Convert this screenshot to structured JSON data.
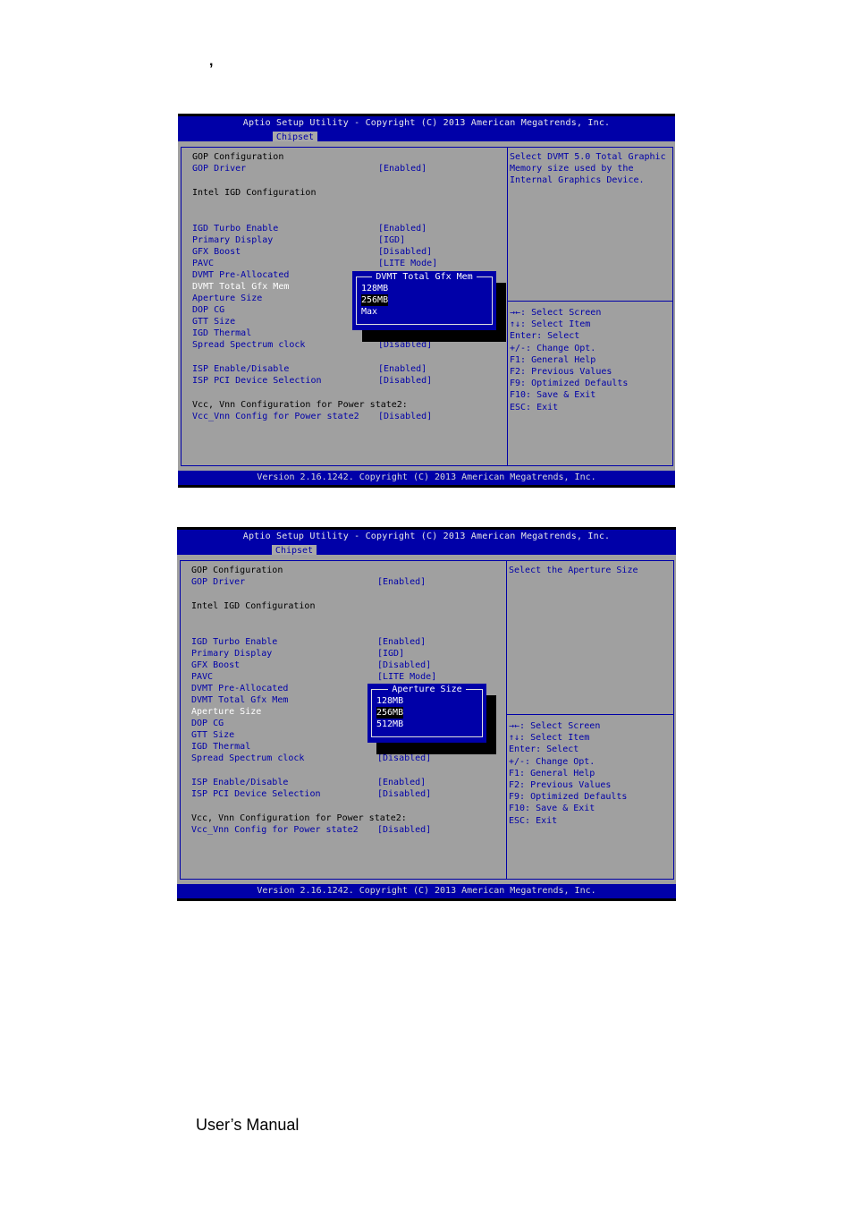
{
  "page": {
    "stray_mark": ",",
    "footer": "User’s Manual"
  },
  "screens": [
    {
      "title": "Aptio Setup Utility - Copyright (C) 2013 American Megatrends, Inc.",
      "active_tab": "Chipset",
      "status": "Version 2.16.1242. Copyright (C) 2013 American Megatrends, Inc.",
      "items": [
        {
          "label": "GOP Configuration",
          "value": ""
        },
        {
          "label": "GOP Driver",
          "value": "[Enabled]"
        },
        {
          "label": "Intel IGD Configuration",
          "value": ""
        },
        {
          "label": "IGD Turbo Enable",
          "value": "[Enabled]"
        },
        {
          "label": "Primary Display",
          "value": "[IGD]"
        },
        {
          "label": "GFX Boost",
          "value": "[Disabled]"
        },
        {
          "label": "PAVC",
          "value": "[LITE Mode]"
        },
        {
          "label": "DVMT Pre-Allocated",
          "value": ""
        },
        {
          "label": "DVMT Total Gfx Mem",
          "value": ""
        },
        {
          "label": "Aperture Size",
          "value": ""
        },
        {
          "label": "DOP CG",
          "value": ""
        },
        {
          "label": "GTT Size",
          "value": ""
        },
        {
          "label": "IGD Thermal",
          "value": ""
        },
        {
          "label": "Spread Spectrum clock",
          "value": "[Disabled]"
        },
        {
          "label": "ISP Enable/Disable",
          "value": "[Enabled]"
        },
        {
          "label": "ISP PCI Device Selection",
          "value": "[Disabled]"
        },
        {
          "label": "Vcc, Vnn Configuration for Power state2:",
          "value": ""
        },
        {
          "label": "Vcc_Vnn Config for Power state2",
          "value": "[Disabled]"
        }
      ],
      "help_text": "Select DVMT 5.0 Total Graphic\nMemory size used by the\nInternal Graphics Device.",
      "keys": "→←: Select Screen\n↑↓: Select Item\nEnter: Select\n+/-: Change Opt.\nF1: General Help\nF2: Previous Values\nF9: Optimized Defaults\nF10: Save & Exit\nESC: Exit",
      "popup": {
        "title": "DVMT Total Gfx Mem",
        "options": [
          "128MB",
          "256MB",
          "Max"
        ],
        "highlighted": "256MB"
      }
    },
    {
      "title": "Aptio Setup Utility - Copyright (C) 2013 American Megatrends, Inc.",
      "active_tab": "Chipset",
      "status": "Version 2.16.1242. Copyright (C) 2013 American Megatrends, Inc.",
      "items": [
        {
          "label": "GOP Configuration",
          "value": ""
        },
        {
          "label": "GOP Driver",
          "value": "[Enabled]"
        },
        {
          "label": "Intel IGD Configuration",
          "value": ""
        },
        {
          "label": "IGD Turbo Enable",
          "value": "[Enabled]"
        },
        {
          "label": "Primary Display",
          "value": "[IGD]"
        },
        {
          "label": "GFX Boost",
          "value": "[Disabled]"
        },
        {
          "label": "PAVC",
          "value": "[LITE Mode]"
        },
        {
          "label": "DVMT Pre-Allocated",
          "value": ""
        },
        {
          "label": "DVMT Total Gfx Mem",
          "value": ""
        },
        {
          "label": "Aperture Size",
          "value": ""
        },
        {
          "label": "DOP CG",
          "value": ""
        },
        {
          "label": "GTT Size",
          "value": ""
        },
        {
          "label": "IGD Thermal",
          "value": ""
        },
        {
          "label": "Spread Spectrum clock",
          "value": "[Disabled]"
        },
        {
          "label": "ISP Enable/Disable",
          "value": "[Enabled]"
        },
        {
          "label": "ISP PCI Device Selection",
          "value": "[Disabled]"
        },
        {
          "label": "Vcc, Vnn Configuration for Power state2:",
          "value": ""
        },
        {
          "label": "Vcc_Vnn Config for Power state2",
          "value": "[Disabled]"
        }
      ],
      "help_text": "Select the Aperture Size",
      "keys": "→←: Select Screen\n↑↓: Select Item\nEnter: Select\n+/-: Change Opt.\nF1: General Help\nF2: Previous Values\nF9: Optimized Defaults\nF10: Save & Exit\nESC: Exit",
      "popup": {
        "title": "Aperture Size",
        "options": [
          "128MB",
          "256MB",
          "512MB"
        ],
        "highlighted": "256MB"
      }
    }
  ]
}
